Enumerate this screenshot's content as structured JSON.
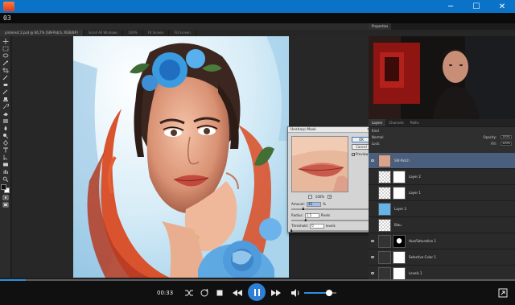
{
  "window": {
    "controls": {
      "minimize": "─",
      "maximize": "☐",
      "close": "✕"
    }
  },
  "episode": {
    "label": "03"
  },
  "photoshop": {
    "tabs": [
      {
        "label": "pinterest 2.psd @ 66,7% (SW-Patch, RGB/8#)"
      },
      {
        "label": "Scroll All Windows"
      },
      {
        "label": "100%"
      },
      {
        "label": "Fit Screen"
      },
      {
        "label": "Fill Screen"
      }
    ],
    "properties_tab": "Properties",
    "layers_tabs": [
      "Layers",
      "Channels",
      "Paths"
    ],
    "layer_controls": {
      "kind": "Kind",
      "mode": "Normal",
      "opacity_label": "Opacity:",
      "opacity": "100%",
      "lock_label": "Lock:",
      "fill_label": "Fill:",
      "fill": "100%"
    },
    "layers": [
      {
        "name": "SW-Patch",
        "selected": true
      },
      {
        "name": "Layer 2"
      },
      {
        "name": "Layer 1"
      },
      {
        "name": "Layer 3"
      },
      {
        "name": "Blau"
      },
      {
        "name": "Hue/Saturation 1"
      },
      {
        "name": "Selective Color 1"
      },
      {
        "name": "Levels 1"
      }
    ],
    "dialog": {
      "title": "Unsharp Mask",
      "ok": "OK",
      "cancel": "Cancel",
      "preview_label": "Preview",
      "zoom": "100%",
      "amount_label": "Amount:",
      "amount_value": "45",
      "amount_unit": "%",
      "amount_fraction": 0.15,
      "radius_label": "Radius:",
      "radius_value": "1,5",
      "radius_unit": "Pixels",
      "radius_fraction": 0.18,
      "threshold_label": "Threshold:",
      "threshold_value": "0",
      "threshold_unit": "levels",
      "threshold_fraction": 0.0
    }
  },
  "player": {
    "time": "00:33",
    "progress": 0.05,
    "volume": 0.75
  }
}
